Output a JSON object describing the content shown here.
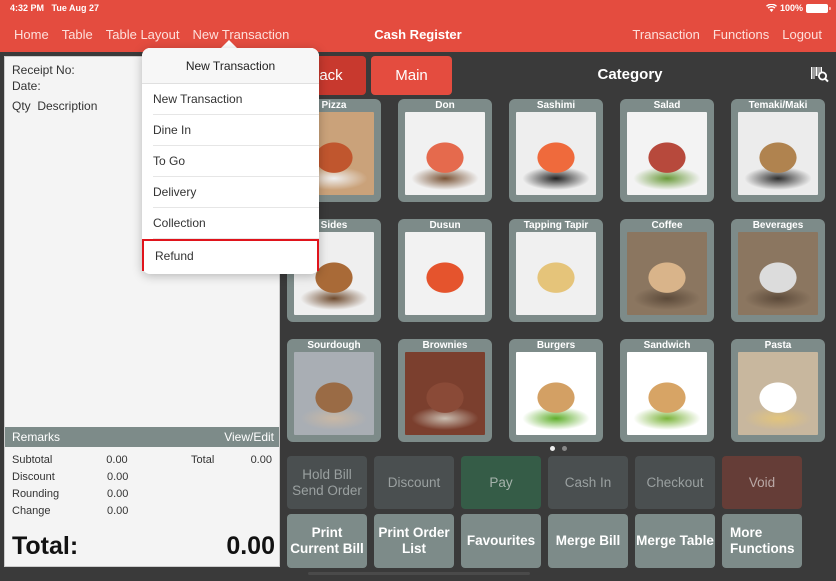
{
  "status_bar": {
    "time": "4:32 PM",
    "date": "Tue Aug 27",
    "battery": "100%"
  },
  "nav": {
    "left": [
      "Home",
      "Table",
      "Table Layout",
      "New Transaction"
    ],
    "title": "Cash Register",
    "right": [
      "Transaction",
      "Functions",
      "Logout"
    ]
  },
  "receipt": {
    "receipt_no_label": "Receipt No:",
    "date_label": "Date:",
    "qty_label": "Qty",
    "description_label": "Description",
    "remarks_label": "Remarks",
    "view_edit_label": "View/Edit",
    "totals": [
      {
        "label": "Subtotal",
        "value": "0.00"
      },
      {
        "label": "Discount",
        "value": "0.00"
      },
      {
        "label": "Rounding",
        "value": "0.00"
      },
      {
        "label": "Change",
        "value": "0.00"
      }
    ],
    "total_small_label": "Total",
    "total_small_value": "0.00",
    "grand_total_label": "Total:",
    "grand_total_value": "0.00"
  },
  "panel": {
    "back_label": "Back",
    "main_label": "Main",
    "category_title": "Category",
    "scan_icon": "barcode-search-icon"
  },
  "categories": [
    {
      "name": "Pizza",
      "colors": [
        "#caa27a",
        "#c0562e",
        "#eee"
      ]
    },
    {
      "name": "Don",
      "colors": [
        "#f1f1f1",
        "#e56a4d",
        "#7a5436"
      ]
    },
    {
      "name": "Sashimi",
      "colors": [
        "#eeeeee",
        "#ef6a3c",
        "#222"
      ]
    },
    {
      "name": "Salad",
      "colors": [
        "#f3f3f3",
        "#b7493c",
        "#6a9a3a"
      ]
    },
    {
      "name": "Temaki/Maki",
      "colors": [
        "#ececec",
        "#b0834f",
        "#2e2e2e"
      ]
    },
    {
      "name": "Sides",
      "colors": [
        "#efefef",
        "#a96a37",
        "#6e4a2d"
      ]
    },
    {
      "name": "Dusun",
      "colors": [
        "#f2f2f2",
        "#e5542d",
        "#f2f2f2"
      ]
    },
    {
      "name": "Tapping Tapir",
      "colors": [
        "#f0f0f0",
        "#e5c47a",
        "#f0f0f0"
      ]
    },
    {
      "name": "Coffee",
      "colors": [
        "#8b7660",
        "#d9b48a",
        "#5c4a3a"
      ]
    },
    {
      "name": "Beverages",
      "colors": [
        "#8b7660",
        "#dcdcdc",
        "#5c4a3a"
      ]
    },
    {
      "name": "Sourdough",
      "colors": [
        "#a9aeb4",
        "#9a6b45",
        "#c9b8a5"
      ]
    },
    {
      "name": "Brownies",
      "colors": [
        "#7b3f2e",
        "#8a4a37",
        "#c9bdb0"
      ]
    },
    {
      "name": "Burgers",
      "colors": [
        "#ffffff",
        "#d3a064",
        "#5fae2b"
      ]
    },
    {
      "name": "Sandwich",
      "colors": [
        "#ffffff",
        "#d7a465",
        "#7bb33a"
      ]
    },
    {
      "name": "Pasta",
      "colors": [
        "#c8b79e",
        "#ffffff",
        "#e2c47c"
      ]
    }
  ],
  "pagination": {
    "pages": 2,
    "current": 1
  },
  "functions_row1": [
    {
      "label": "Hold Bill\nSend Order",
      "style": "dim"
    },
    {
      "label": "Discount",
      "style": "dim"
    },
    {
      "label": "Pay",
      "style": "pay"
    },
    {
      "label": "Cash In",
      "style": "dim"
    },
    {
      "label": "Checkout",
      "style": "dim"
    },
    {
      "label": "Void",
      "style": "void"
    }
  ],
  "functions_row2": [
    {
      "label": "Print\nCurrent Bill"
    },
    {
      "label": "Print Order\nList"
    },
    {
      "label": "Favourites"
    },
    {
      "label": "Merge Bill"
    },
    {
      "label": "Merge Table"
    },
    {
      "label": "More\nFunctions"
    }
  ],
  "popover": {
    "title": "New Transaction",
    "items": [
      "New Transaction",
      "Dine In",
      "To Go",
      "Delivery",
      "Collection",
      "Refund"
    ],
    "selected": "Refund"
  },
  "colors": {
    "brand": "#e44c3f",
    "tile": "#7d8b89",
    "pay": "#355c47",
    "void": "#653d37",
    "highlight": "#e0141c"
  }
}
